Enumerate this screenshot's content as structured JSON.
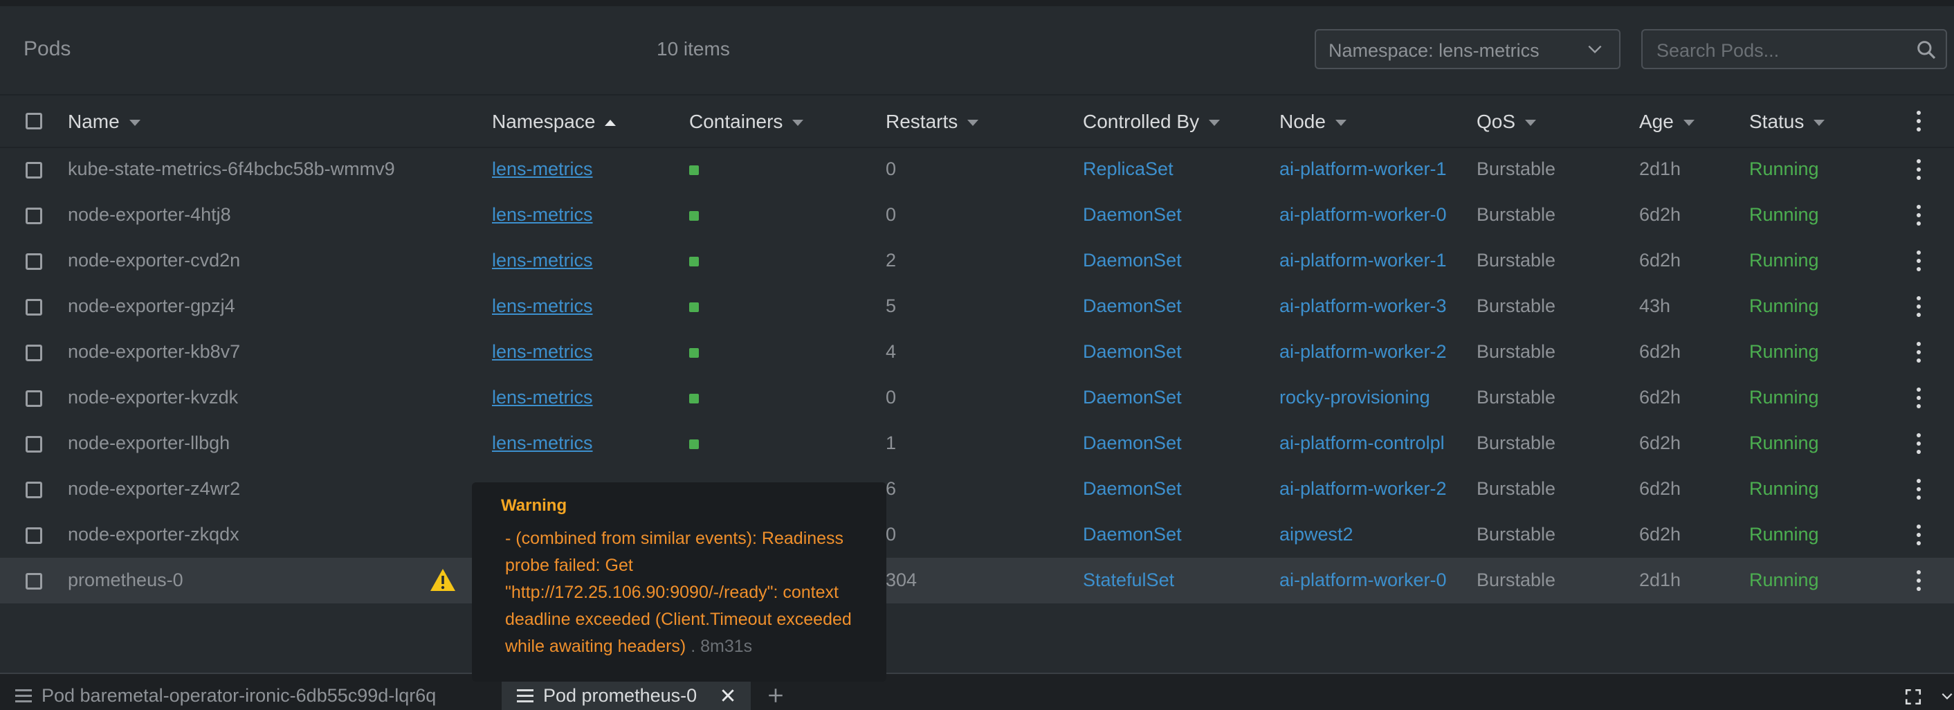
{
  "header": {
    "title": "Pods",
    "count": "10 items",
    "namespace_select": "Namespace: lens-metrics",
    "search_placeholder": "Search Pods..."
  },
  "columns": {
    "name": "Name",
    "namespace": "Namespace",
    "containers": "Containers",
    "restarts": "Restarts",
    "controlled_by": "Controlled By",
    "node": "Node",
    "qos": "QoS",
    "age": "Age",
    "status": "Status"
  },
  "rows": [
    {
      "name": "kube-state-metrics-6f4bcbc58b-wmmv9",
      "namespace": "lens-metrics",
      "restarts": "0",
      "controlled_by": "ReplicaSet",
      "node": "ai-platform-worker-1",
      "qos": "Burstable",
      "age": "2d1h",
      "status": "Running"
    },
    {
      "name": "node-exporter-4htj8",
      "namespace": "lens-metrics",
      "restarts": "0",
      "controlled_by": "DaemonSet",
      "node": "ai-platform-worker-0",
      "qos": "Burstable",
      "age": "6d2h",
      "status": "Running"
    },
    {
      "name": "node-exporter-cvd2n",
      "namespace": "lens-metrics",
      "restarts": "2",
      "controlled_by": "DaemonSet",
      "node": "ai-platform-worker-1",
      "qos": "Burstable",
      "age": "6d2h",
      "status": "Running"
    },
    {
      "name": "node-exporter-gpzj4",
      "namespace": "lens-metrics",
      "restarts": "5",
      "controlled_by": "DaemonSet",
      "node": "ai-platform-worker-3",
      "qos": "Burstable",
      "age": "43h",
      "status": "Running"
    },
    {
      "name": "node-exporter-kb8v7",
      "namespace": "lens-metrics",
      "restarts": "4",
      "controlled_by": "DaemonSet",
      "node": "ai-platform-worker-2",
      "qos": "Burstable",
      "age": "6d2h",
      "status": "Running"
    },
    {
      "name": "node-exporter-kvzdk",
      "namespace": "lens-metrics",
      "restarts": "0",
      "controlled_by": "DaemonSet",
      "node": "rocky-provisioning",
      "qos": "Burstable",
      "age": "6d2h",
      "status": "Running"
    },
    {
      "name": "node-exporter-llbgh",
      "namespace": "lens-metrics",
      "restarts": "1",
      "controlled_by": "DaemonSet",
      "node": "ai-platform-controlpl",
      "qos": "Burstable",
      "age": "6d2h",
      "status": "Running"
    },
    {
      "name": "node-exporter-z4wr2",
      "namespace": "",
      "restarts": "6",
      "controlled_by": "DaemonSet",
      "node": "ai-platform-worker-2",
      "qos": "Burstable",
      "age": "6d2h",
      "status": "Running"
    },
    {
      "name": "node-exporter-zkqdx",
      "namespace": "",
      "restarts": "0",
      "controlled_by": "DaemonSet",
      "node": "aipwest2",
      "qos": "Burstable",
      "age": "6d2h",
      "status": "Running"
    },
    {
      "name": "prometheus-0",
      "namespace": "",
      "restarts": "304",
      "controlled_by": "StatefulSet",
      "node": "ai-platform-worker-0",
      "qos": "Burstable",
      "age": "2d1h",
      "status": "Running"
    }
  ],
  "tooltip": {
    "title": "Warning",
    "message": "- (combined from similar events): Readiness probe failed: Get \"http://172.25.106.90:9090/-/ready\": context deadline exceeded (Client.Timeout exceeded while awaiting headers)",
    "age": " . 8m31s"
  },
  "dock": {
    "tab1": "Pod baremetal-operator-ironic-6db55c99d-lqr6q",
    "tab2": "Pod prometheus-0"
  },
  "colors": {
    "link": "#3d90ce",
    "running": "#4caf50",
    "warning": "#f5a623"
  }
}
